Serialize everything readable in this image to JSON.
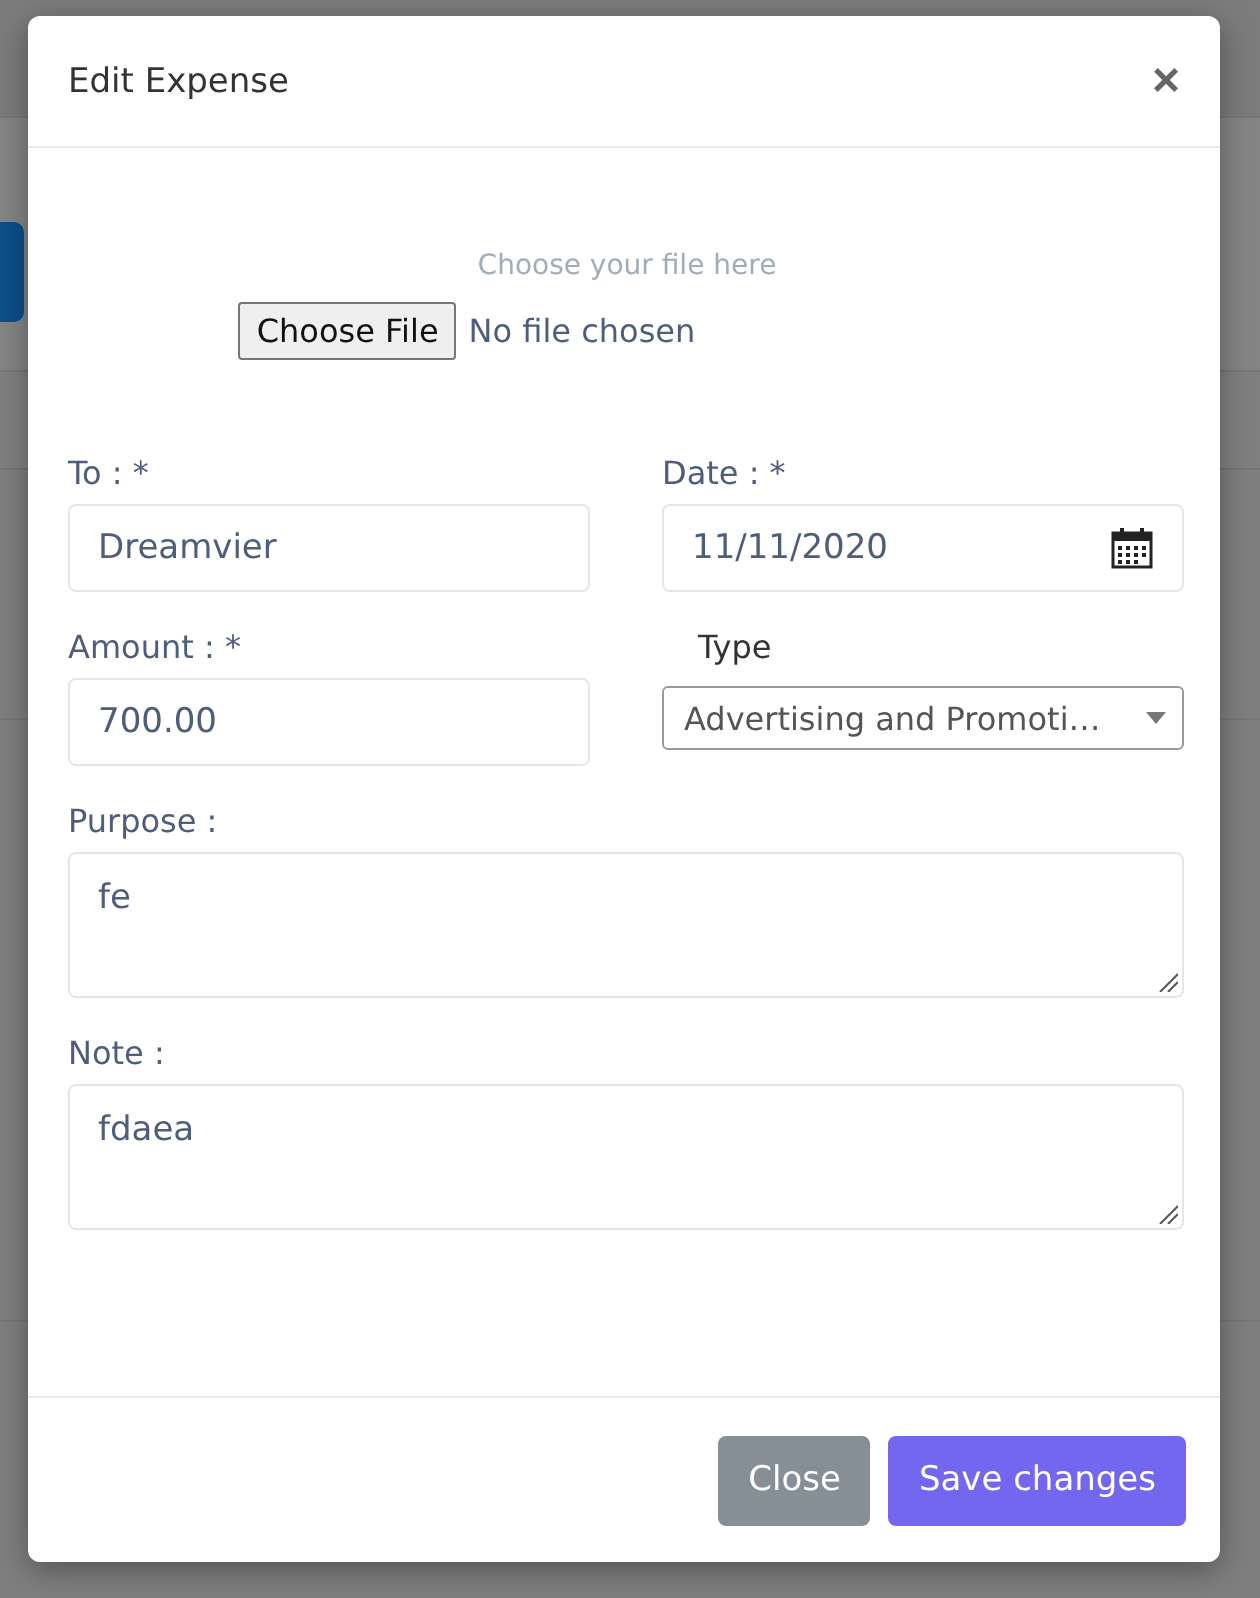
{
  "dialog": {
    "title": "Edit Expense",
    "close_glyph": "×"
  },
  "upload": {
    "hint": "Choose your file here",
    "button": "Choose File",
    "status": "No file chosen"
  },
  "fields": [
    {
      "kind": "text",
      "label": "To : *",
      "value": "Dreamvier"
    },
    {
      "kind": "date",
      "label": "Date : *",
      "value": "11/11/2020"
    },
    {
      "kind": "text",
      "label": "Amount : *",
      "value": "700.00"
    },
    {
      "kind": "select",
      "label": "Type",
      "value": "Advertising and Promoti…"
    },
    {
      "kind": "textarea",
      "label": "Purpose :",
      "value": "fe"
    },
    {
      "kind": "textarea",
      "label": "Note :",
      "value": "fdaea"
    }
  ],
  "buttons": [
    {
      "kind": "secondary",
      "label": "Close"
    },
    {
      "kind": "primary",
      "label": "Save changes"
    }
  ]
}
